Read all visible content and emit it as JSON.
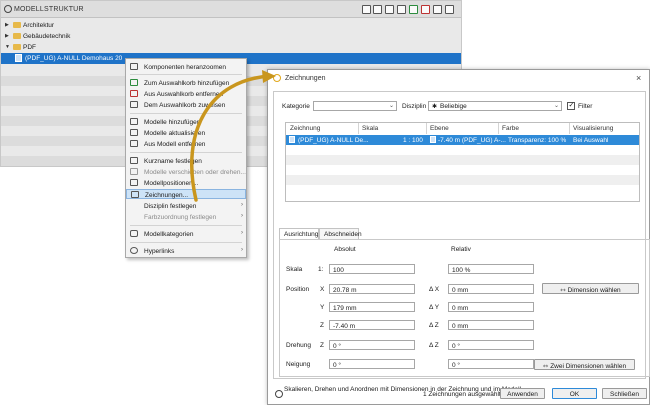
{
  "tree": {
    "title": "MODELLSTRUKTUR",
    "items": [
      {
        "label": "Architektur"
      },
      {
        "label": "Gebäudetechnik"
      },
      {
        "label": "PDF"
      },
      {
        "label": "(PDF_UG) A-NULL Demohaus 20"
      }
    ]
  },
  "context_menu": {
    "items": [
      {
        "label": "Komponenten heranzoomen"
      },
      {
        "label": "Zum Auswahlkorb hinzufügen"
      },
      {
        "label": "Aus Auswahlkorb entfernen"
      },
      {
        "label": "Dem Auswahlkorb zuweisen"
      },
      {
        "label": "Modelle hinzufügen"
      },
      {
        "label": "Modelle aktualisieren"
      },
      {
        "label": "Aus Modell entfernen"
      },
      {
        "label": "Kurzname festlegen"
      },
      {
        "label": "Modelle verschieben oder drehen..."
      },
      {
        "label": "Modellpositionen..."
      },
      {
        "label": "Zeichnungen..."
      },
      {
        "label": "Disziplin festlegen"
      },
      {
        "label": "Farbzuordnung festlegen"
      },
      {
        "label": "Modellkategorien"
      },
      {
        "label": "Hyperlinks"
      }
    ]
  },
  "dialog": {
    "title": "Zeichnungen",
    "kategorie_label": "Kategorie",
    "kategorie_value": "",
    "disziplin_label": "Disziplin",
    "disziplin_value": "Beliebige",
    "filter_label": "Filter",
    "grid": {
      "headers": [
        "Zeichnung",
        "Skala",
        "Ebene",
        "Farbe",
        "Visualisierung"
      ],
      "row": {
        "zeichnung": "(PDF_UG) A-NULL De...",
        "skala": "1 : 100",
        "ebene": "-7.40 m (PDF_UG) A-...",
        "farbe": "Transparenz: 100 %",
        "visualisierung": "Bei Auswahl"
      }
    },
    "tabs": [
      "Ausrichtung",
      "Abschneiden"
    ],
    "absolut_label": "Absolut",
    "relativ_label": "Relativ",
    "skala_label": "Skala",
    "skala_prefix": "1:",
    "skala_abs": "100",
    "skala_rel": "100 %",
    "position_label": "Position",
    "x_label": "X",
    "y_label": "Y",
    "z_label": "Z",
    "dx_label": "Δ X",
    "dy_label": "Δ Y",
    "dz_label": "Δ Z",
    "pos_x": "20.78 m",
    "pos_y": "179 mm",
    "pos_z": "-7.40 m",
    "rel_x": "0 mm",
    "rel_y": "0 mm",
    "rel_z": "0 mm",
    "drehung_label": "Drehung",
    "drehung_abs": "0 °",
    "drehung_rel": "0 °",
    "neigung_label": "Neigung",
    "neigung_abs": "0 °",
    "neigung_rel": "0 °",
    "dimension_button": "Dimension wählen",
    "info_text": "Skalieren, Drehen und Anordnen mit Dimensionen in der Zeichnung und im Modell",
    "two_dimensions_button": "Zwei Dimensionen wählen",
    "status": "1 Zeichnungen ausgewählt",
    "apply_button": "Anwenden",
    "ok_button": "OK",
    "close_button": "Schließen"
  },
  "colors": {
    "accent_selection": "#2e8ad8",
    "folder": "#e7b94a",
    "arrow": "#c9961e"
  }
}
